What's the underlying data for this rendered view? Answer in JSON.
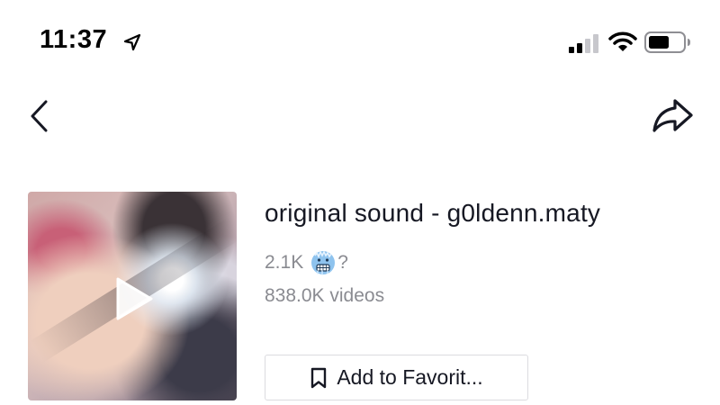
{
  "status_bar": {
    "time": "11:37",
    "icons": [
      "location-arrow-icon",
      "cellular-signal-icon",
      "wifi-icon",
      "battery-icon"
    ]
  },
  "nav": {
    "back_icon": "chevron-left-icon",
    "share_icon": "share-arrow-icon"
  },
  "sound": {
    "title": "original sound - g0ldenn.maty",
    "creator_prefix": "2.1K",
    "creator_emoji_icon": "cold-face-emoji-icon",
    "creator_suffix": "?",
    "video_count": "838.0K videos",
    "cover_play_icon": "play-icon"
  },
  "favorite_button": {
    "label": "Add to Favorit...",
    "icon": "bookmark-icon"
  },
  "colors": {
    "text_primary": "#161823",
    "text_secondary": "#8a8b91",
    "button_border": "#dcdce0",
    "emoji_blue": "#7fb7e6"
  }
}
